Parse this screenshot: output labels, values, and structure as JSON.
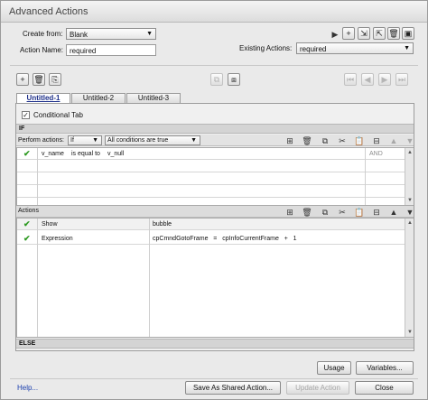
{
  "window": {
    "title": "Advanced Actions"
  },
  "form": {
    "create_from_label": "Create from:",
    "create_from_value": "Blank",
    "action_name_label": "Action Name:",
    "action_name_value": "required",
    "existing_actions_label": "Existing Actions:",
    "existing_actions_value": "required"
  },
  "top_icons": [
    "play-icon",
    "add-action-icon",
    "import-icon",
    "export-icon",
    "delete-action-icon",
    "save-icon"
  ],
  "tabs": [
    {
      "label": "Untitled-1",
      "active": true
    },
    {
      "label": "Untitled-2",
      "active": false
    },
    {
      "label": "Untitled-3",
      "active": false
    }
  ],
  "conditional_tab_label": "Conditional Tab",
  "if_section": {
    "header": "IF",
    "perform_actions_label": "Perform actions:",
    "perform_actions_value": "If",
    "condition_mode_value": "All conditions are true",
    "conditions": [
      {
        "checked": true,
        "variable": "v_name",
        "operator": "is equal to",
        "value": "v_null",
        "logic": "AND"
      }
    ]
  },
  "actions_section": {
    "header": "Actions",
    "rows": [
      {
        "checked": true,
        "action": "Show",
        "target": "bubble"
      },
      {
        "checked": true,
        "action": "Expression",
        "target": "cpCmndGotoFrame   =   cpInfoCurrentFrame   +   1"
      }
    ]
  },
  "else_section": {
    "header": "ELSE"
  },
  "buttons": {
    "usage": "Usage",
    "variables": "Variables...",
    "help": "Help...",
    "save_shared": "Save As Shared Action...",
    "update_action": "Update Action",
    "close": "Close"
  }
}
